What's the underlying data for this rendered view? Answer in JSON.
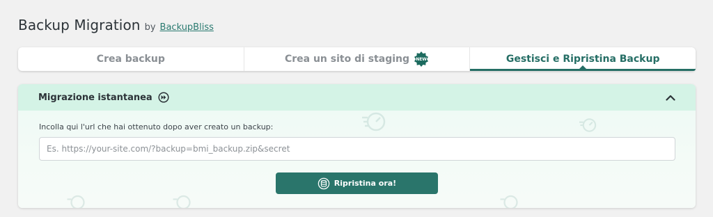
{
  "header": {
    "title": "Backup Migration",
    "by": "by",
    "brand": "BackupBliss"
  },
  "tabs": [
    {
      "label": "Crea backup",
      "active": false
    },
    {
      "label": "Crea un sito di staging",
      "badge": "NEW",
      "active": false
    },
    {
      "label": "Gestisci e Ripristina Backup",
      "active": true
    }
  ],
  "panel": {
    "title": "Migrazione istantanea",
    "field_label": "Incolla qui l'url che hai ottenuto dopo aver creato un backup:",
    "input_placeholder": "Es. https://your-site.com/?backup=bmi_backup.zip&secret",
    "input_value": "",
    "button_label": "Ripristina ora!"
  },
  "colors": {
    "accent": "#256e65",
    "button": "#2a756b",
    "panel_header": "#d4f3e6",
    "badge": "#1d6b5f"
  },
  "icons": {
    "fast_forward": "fast-forward-circle-icon",
    "collapse": "chevron-up-icon",
    "restore": "database-restore-icon",
    "new_badge": "new-badge-icon"
  }
}
